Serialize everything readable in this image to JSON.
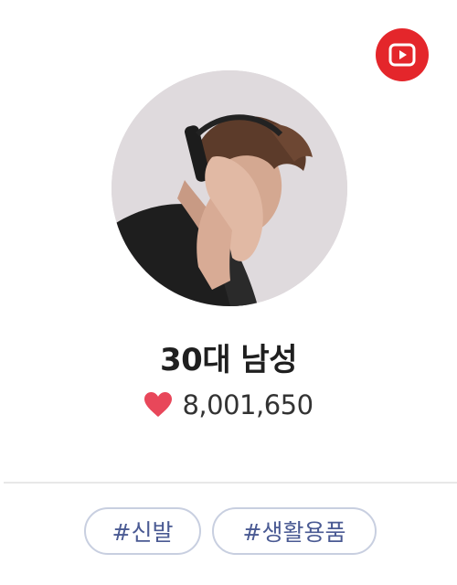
{
  "profile": {
    "name": "30대 남성",
    "likes": "8,001,650",
    "avatar_icon": "person-with-headphones-photo"
  },
  "youtube": {
    "icon": "youtube-play-icon",
    "color": "#e4262b"
  },
  "heart": {
    "icon": "heart-icon",
    "color": "#e8475a"
  },
  "tags": [
    {
      "label": "#신발"
    },
    {
      "label": "#생활용품"
    }
  ]
}
